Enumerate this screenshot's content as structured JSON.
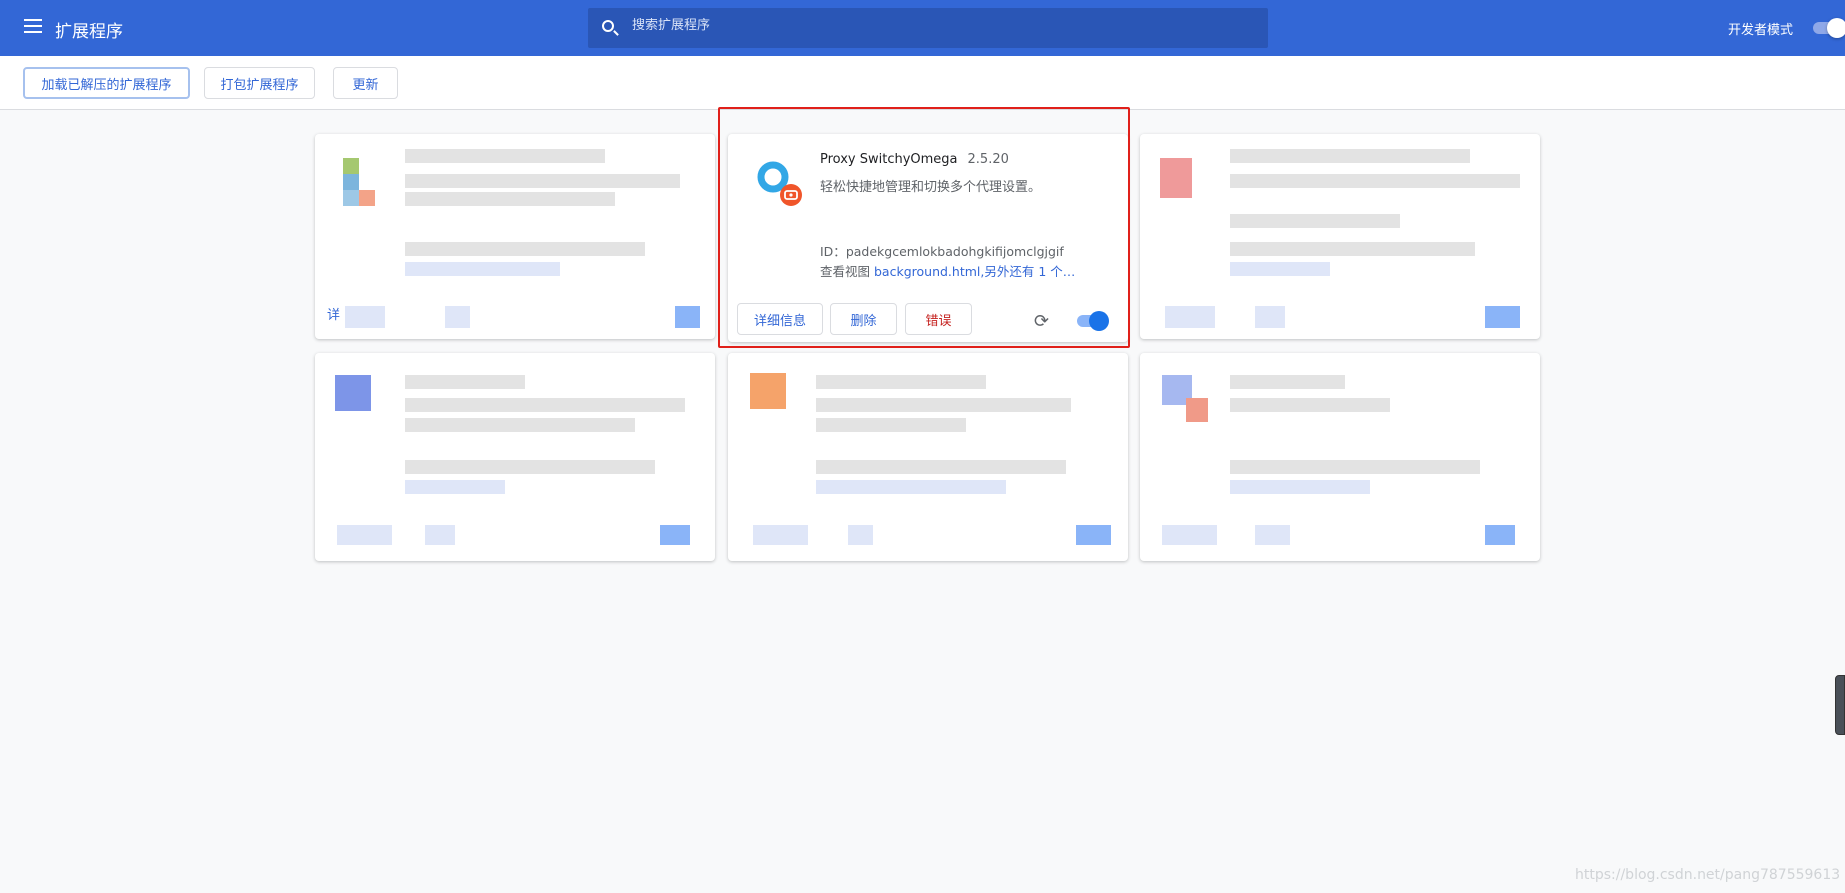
{
  "header": {
    "title": "扩展程序",
    "search_placeholder": "搜索扩展程序",
    "dev_mode_label": "开发者模式",
    "dev_mode_on": true
  },
  "toolbar": {
    "load_unpacked": "加载已解压的扩展程序",
    "pack": "打包扩展程序",
    "update": "更新"
  },
  "extension": {
    "name": "Proxy SwitchyOmega",
    "version": "2.5.20",
    "description": "轻松快捷地管理和切换多个代理设置。",
    "id_label": "ID：",
    "id": "padekgcemlokbadohgkifijomclgjgif",
    "views_label": "查看视图",
    "views_link": "background.html,另外还有 1 个…",
    "details_button": "详细信息",
    "remove_button": "删除",
    "errors_button": "错误",
    "enabled": true,
    "colors": {
      "ring": "#32a7e6",
      "badge": "#f0552a"
    }
  },
  "blurred_card_fragment": "详",
  "watermark": "https://blog.csdn.net/pang787559613"
}
